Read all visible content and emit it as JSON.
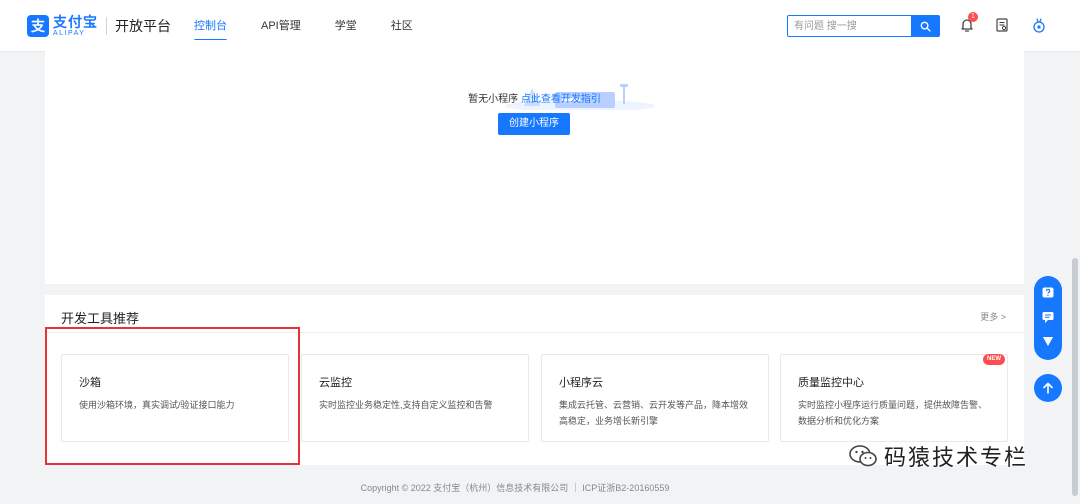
{
  "header": {
    "logo_mark": "支",
    "logo_cn": "支付宝",
    "logo_en": "ALIPAY",
    "platform": "开放平台",
    "nav": [
      {
        "label": "控制台",
        "active": true
      },
      {
        "label": "API管理",
        "active": false
      },
      {
        "label": "学堂",
        "active": false
      },
      {
        "label": "社区",
        "active": false
      }
    ],
    "search_placeholder": "有问题 搜一搜",
    "notification_count": "1",
    "icons": [
      "search-icon",
      "bell-icon",
      "document-icon",
      "robot-icon"
    ]
  },
  "empty_state": {
    "text": "暂无小程序",
    "link": "点此查看开发指引",
    "create_button": "创建小程序"
  },
  "tools": {
    "title": "开发工具推荐",
    "more": "更多 >",
    "items": [
      {
        "name": "沙箱",
        "desc": "使用沙箱环境，真实调试/验证接口能力"
      },
      {
        "name": "云监控",
        "desc": "实时监控业务稳定性,支持自定义监控和告警"
      },
      {
        "name": "小程序云",
        "desc": "集成云托管、云营销、云开发等产品，降本增效高稳定，业务增长新引擎"
      },
      {
        "name": "质量监控中心",
        "desc": "实时监控小程序运行质量问题，提供故障告警、数据分析和优化方案",
        "badge": "NEW"
      }
    ]
  },
  "footer": {
    "copyright": "Copyright © 2022 支付宝（杭州）信息技术有限公司 ｜ ICP证浙B2-20160559"
  },
  "watermark": "码猿技术专栏",
  "colors": {
    "accent": "#1677ff",
    "highlight": "#e5333b",
    "badge": "#ff4d4f"
  }
}
